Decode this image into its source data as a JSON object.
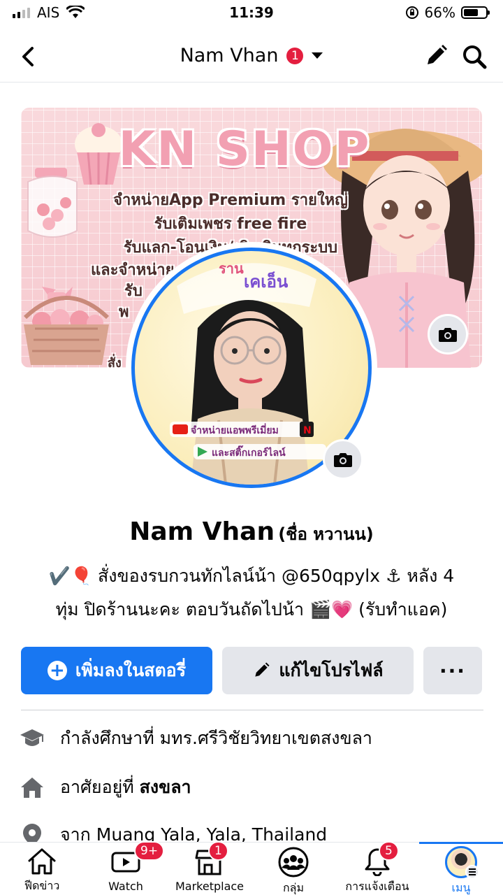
{
  "status_bar": {
    "carrier": "AIS",
    "time": "11:39",
    "battery_percent": "66%",
    "battery_level": 0.66
  },
  "header": {
    "title": "Nam Vhan",
    "badge_count": "1",
    "back_icon": "chevron-left-icon",
    "edit_icon": "pencil-icon",
    "search_icon": "search-icon"
  },
  "cover": {
    "title": "KN SHOP",
    "lines": [
      "จำหน่ายApp Premium รายใหญ่",
      "รับเติมเพชร free fire",
      "รับแลก-โอนเงิน/เติมเงินทุกระบบ",
      "และจำหน่าย",
      "รับ",
      "พ",
      "สั่ง"
    ]
  },
  "avatar": {
    "sticker_top": "ราน",
    "sticker_name": "เคเอ็น",
    "caption_1": "จำหน่ายแอพพรีเมี่ยม",
    "caption_2": "และสติ๊กเกอร์ไลน์"
  },
  "profile": {
    "name": "Nam Vhan",
    "alt_name": "(ชื่อ หวานน)",
    "bio_line_1": "✔️🎈 สั่งของรบกวนทักไลน์น้า @650qpylx ⚓ หลัง 4",
    "bio_line_2": "ทุ่ม ปิดร้านนะคะ ตอบวันถัดไปน้า 🎬💗 (รับทำแอค)"
  },
  "actions": {
    "add_story": "เพิ่มลงในสตอรี่",
    "edit_profile": "แก้ไขโปรไฟล์",
    "more": "···"
  },
  "info": [
    {
      "icon": "graduation-cap-icon",
      "prefix": "กำลังศึกษาที่ มทร.ศรีวิชัยวิทยาเขตสงขลา",
      "bold": ""
    },
    {
      "icon": "home-icon",
      "prefix": "อาศัยอยู่ที่ ",
      "bold": "สงขลา"
    },
    {
      "icon": "location-pin-icon",
      "prefix": "จาก ",
      "bold": "Muang Yala, Yala, Thailand"
    }
  ],
  "bottom_nav": [
    {
      "label": "ฟีดข่าว",
      "icon": "home-icon",
      "badge": ""
    },
    {
      "label": "Watch",
      "icon": "video-icon",
      "badge": "9+"
    },
    {
      "label": "Marketplace",
      "icon": "store-icon",
      "badge": "1"
    },
    {
      "label": "กลุ่ม",
      "icon": "groups-icon",
      "badge": ""
    },
    {
      "label": "การแจ้งเตือน",
      "icon": "bell-icon",
      "badge": "5"
    },
    {
      "label": "เมนู",
      "icon": "menu-avatar-icon",
      "badge": ""
    }
  ],
  "colors": {
    "accent": "#1877f2",
    "badge": "#e41e3f",
    "button_gray": "#e4e6eb"
  }
}
